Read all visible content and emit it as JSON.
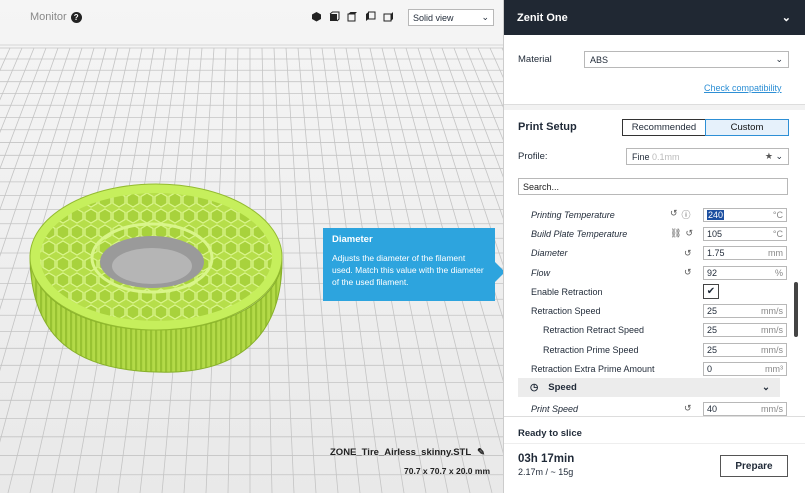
{
  "topbar": {
    "monitor": "Monitor",
    "view_select": "Solid view"
  },
  "tooltip": {
    "title": "Diameter",
    "body": "Adjusts the diameter of the filament used. Match this value with the diameter of the used filament."
  },
  "model": {
    "filename": "ZONE_Tire_Airless_skinny.STL",
    "dimensions": "70.7 x 70.7 x 20.0 mm",
    "color": "#c6ef5c"
  },
  "panel": {
    "printer": "Zenit One",
    "material_label": "Material",
    "material_value": "ABS",
    "compatibility_link": "Check compatibility",
    "print_setup": "Print Setup",
    "mode_recommended": "Recommended",
    "mode_custom": "Custom",
    "profile_label": "Profile:",
    "profile_value": "Fine",
    "profile_hint": "0.1mm",
    "search_value": "Search...",
    "settings": [
      {
        "name": "Printing Temperature",
        "value": "240",
        "unit": "°C"
      },
      {
        "name": "Build Plate Temperature",
        "value": "105",
        "unit": "°C"
      },
      {
        "name": "Diameter",
        "value": "1.75",
        "unit": "mm"
      },
      {
        "name": "Flow",
        "value": "92",
        "unit": "%"
      },
      {
        "name": "Enable Retraction",
        "value": "✔",
        "unit": ""
      },
      {
        "name": "Retraction Speed",
        "value": "25",
        "unit": "mm/s"
      },
      {
        "name": "Retraction Retract Speed",
        "value": "25",
        "unit": "mm/s"
      },
      {
        "name": "Retraction Prime Speed",
        "value": "25",
        "unit": "mm/s"
      },
      {
        "name": "Retraction Extra Prime Amount",
        "value": "0",
        "unit": "mm³"
      }
    ],
    "speed_section": "Speed",
    "print_speed": {
      "name": "Print Speed",
      "value": "40",
      "unit": "mm/s"
    },
    "ready": "Ready to slice",
    "time": "03h 17min",
    "material_use": "2.17m / ~ 15g",
    "prepare": "Prepare"
  },
  "colors": {
    "accent": "#2da4de",
    "header": "#202833"
  }
}
